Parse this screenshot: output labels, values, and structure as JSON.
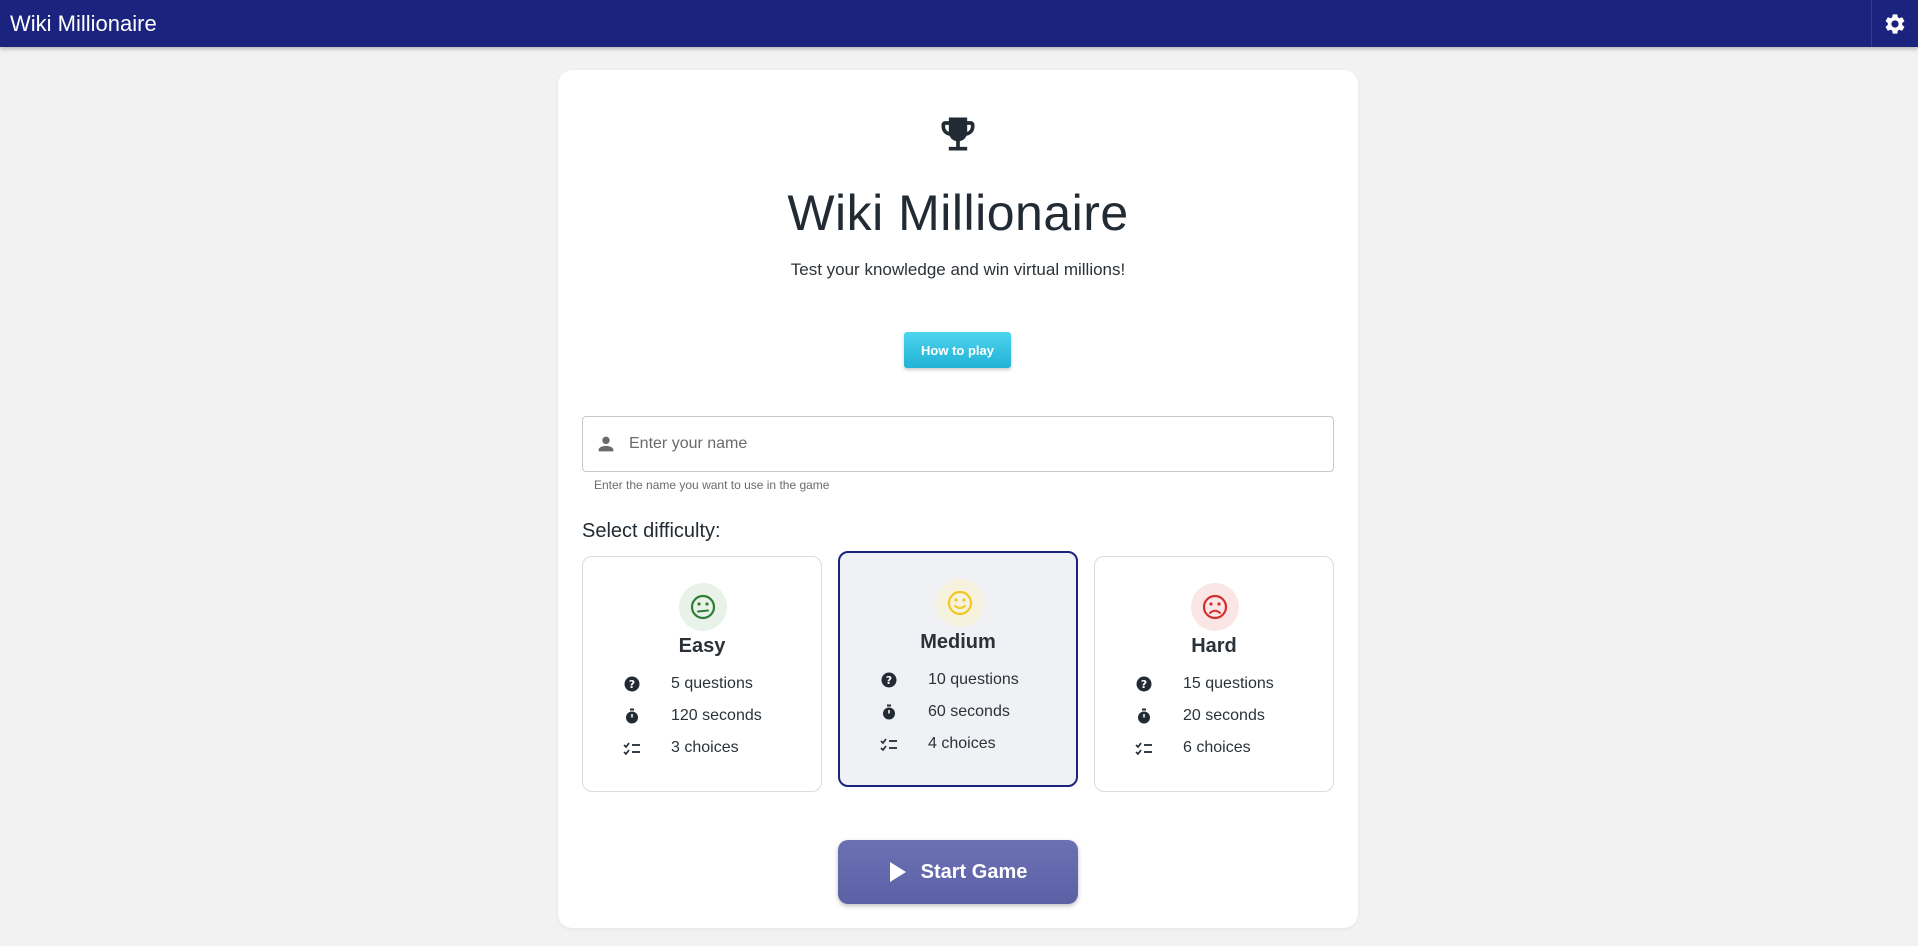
{
  "app": {
    "title": "Wiki Millionaire"
  },
  "hero": {
    "title": "Wiki Millionaire",
    "subtitle": "Test your knowledge and win virtual millions!"
  },
  "how_to_play": {
    "label": "How to play"
  },
  "name_field": {
    "placeholder": "Enter your name",
    "value": "",
    "helper": "Enter the name you want to use in the game"
  },
  "difficulty": {
    "label": "Select difficulty:",
    "selected": "Medium",
    "options": [
      {
        "name": "Easy",
        "questions": "5 questions",
        "seconds": "120 seconds",
        "choices": "3 choices",
        "face_color": "#2e7d32",
        "face_bg": "#e8f2e9"
      },
      {
        "name": "Medium",
        "questions": "10 questions",
        "seconds": "60 seconds",
        "choices": "4 choices",
        "face_color": "#f2c81e",
        "face_bg": "#f7f2dd"
      },
      {
        "name": "Hard",
        "questions": "15 questions",
        "seconds": "20 seconds",
        "choices": "6 choices",
        "face_color": "#d32f2f",
        "face_bg": "#fbe6e6"
      }
    ]
  },
  "start": {
    "label": "Start Game"
  },
  "colors": {
    "topbar": "#1a237e",
    "accent": "#1a237e",
    "how_to_play": "#26b8db",
    "start": "#6468ac"
  },
  "icons": [
    "settings-icon",
    "trophy-icon",
    "person-icon",
    "question-icon",
    "timer-icon",
    "checklist-icon",
    "play-icon"
  ]
}
